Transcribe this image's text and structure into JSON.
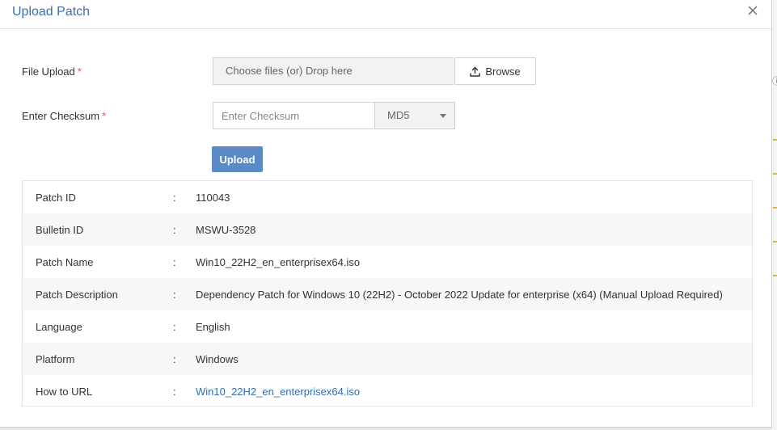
{
  "dialog": {
    "title": "Upload Patch"
  },
  "form": {
    "file_upload_label": "File Upload",
    "required_mark": "*",
    "file_placeholder": "Choose files (or) Drop here",
    "browse_label": "Browse",
    "checksum_label": "Enter Checksum",
    "checksum_placeholder": "Enter Checksum",
    "checksum_algorithm": "MD5",
    "upload_label": "Upload"
  },
  "details": {
    "separator": ":",
    "rows": [
      {
        "key": "Patch ID",
        "value": "110043"
      },
      {
        "key": "Bulletin ID",
        "value": "MSWU-3528"
      },
      {
        "key": "Patch Name",
        "value": "Win10_22H2_en_enterprisex64.iso"
      },
      {
        "key": "Patch Description",
        "value": "Dependency Patch for Windows 10 (22H2) - October 2022 Update for enterprise (x64) (Manual Upload Required)"
      },
      {
        "key": "Language",
        "value": "English"
      },
      {
        "key": "Platform",
        "value": "Windows"
      },
      {
        "key": "How to URL",
        "value": "Win10_22H2_en_enterprisex64.iso"
      }
    ]
  },
  "colors": {
    "title": "#3f6ea8",
    "primary_button": "#5b8ac7",
    "link": "#2f6db5",
    "required": "#d9534f"
  },
  "icons": {
    "close": "close-icon",
    "browse": "upload-icon",
    "dropdown": "caret-down-icon"
  }
}
